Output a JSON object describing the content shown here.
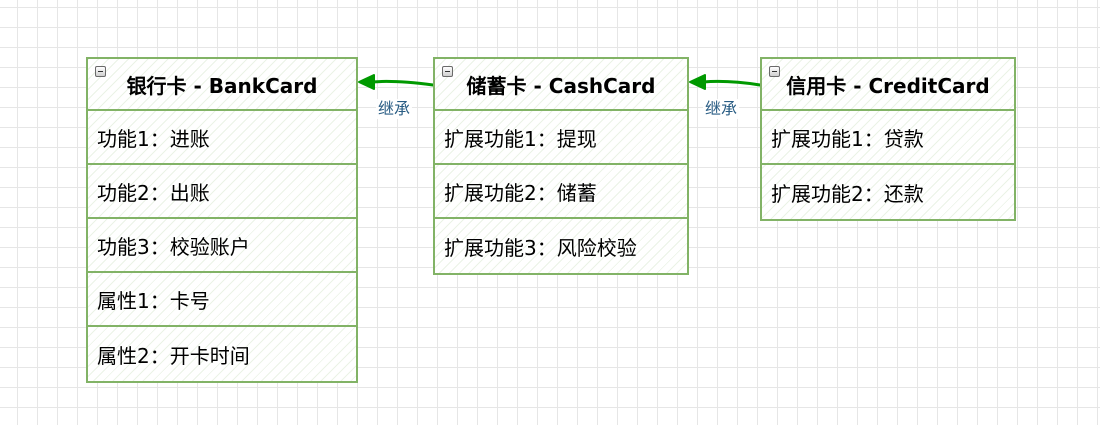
{
  "classes": [
    {
      "title": "银行卡 - BankCard",
      "rows": [
        "功能1：进账",
        "功能2：出账",
        "功能3：校验账户",
        "属性1：卡号",
        "属性2：开卡时间"
      ]
    },
    {
      "title": "储蓄卡 - CashCard",
      "rows": [
        "扩展功能1：提现",
        "扩展功能2：储蓄",
        "扩展功能3：风险校验"
      ]
    },
    {
      "title": "信用卡 - CreditCard",
      "rows": [
        "扩展功能1：贷款",
        "扩展功能2：还款"
      ]
    }
  ],
  "edges": [
    {
      "label": "继承",
      "from": "储蓄卡 - CashCard",
      "to": "银行卡 - BankCard"
    },
    {
      "label": "继承",
      "from": "信用卡 - CreditCard",
      "to": "储蓄卡 - CashCard"
    }
  ],
  "colors": {
    "border": "#82b366",
    "arrow": "#009900",
    "label": "#2a5d84",
    "grid": "#e6e6e6"
  }
}
